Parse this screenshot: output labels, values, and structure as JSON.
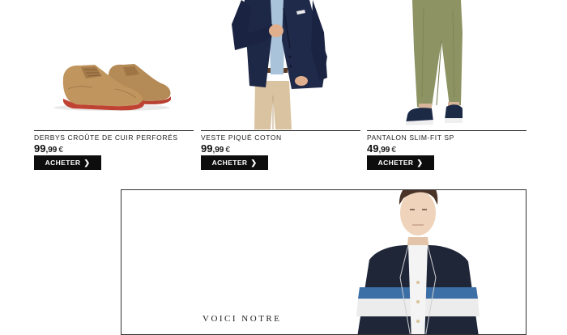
{
  "products": [
    {
      "name": "DERBYS CROÛTE DE CUIR PERFORÉS",
      "price_int": "99",
      "price_dec": ",99",
      "currency": "€",
      "button_label": "ACHETER",
      "button_icon": "chevron-right-icon"
    },
    {
      "name": "VESTE PIQUÉ COTON",
      "price_int": "99",
      "price_dec": ",99",
      "currency": "€",
      "button_label": "ACHETER",
      "button_icon": "chevron-right-icon"
    },
    {
      "name": "PANTALON SLIM-FIT SP",
      "price_int": "49",
      "price_dec": ",99",
      "currency": "€",
      "button_label": "ACHETER",
      "button_icon": "chevron-right-icon"
    }
  ],
  "promo": {
    "headline": "VOICI NOTRE"
  },
  "colors": {
    "button_bg": "#0d0d0d",
    "button_text": "#ffffff",
    "rule": "#1a1a1a",
    "background": "#ffffff"
  }
}
